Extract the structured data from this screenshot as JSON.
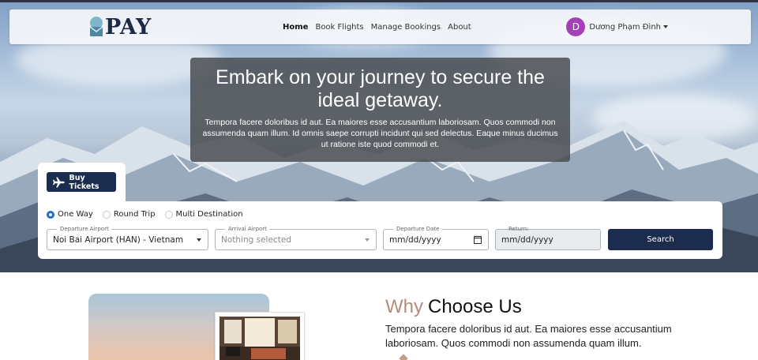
{
  "brand": {
    "logo_text": "PAY"
  },
  "nav": {
    "links": [
      {
        "label": "Home",
        "active": true
      },
      {
        "label": "Book Flights",
        "active": false
      },
      {
        "label": "Manage Bookings",
        "active": false
      },
      {
        "label": "About",
        "active": false
      }
    ]
  },
  "user": {
    "initial": "D",
    "name": "Dương Phạm Đình"
  },
  "hero": {
    "title": "Embark on your journey to secure the ideal getaway.",
    "subtitle": "Tempora facere doloribus id aut. Ea maiores esse accusantium laboriosam. Quos commodi non assumenda quam illum. Id omnis saepe corrupti incidunt qui sed delectus. Eaque minus ducimus ut ratione iste quod commodi et."
  },
  "booking": {
    "tab_label": "Buy Tickets",
    "trip_types": [
      {
        "label": "One Way",
        "selected": true
      },
      {
        "label": "Round Trip",
        "selected": false
      },
      {
        "label": "Multi Destination",
        "selected": false
      }
    ],
    "departure_airport": {
      "label": "Departure Airport",
      "value": "Noi Bai Airport (HAN) - Vietnam"
    },
    "arrival_airport": {
      "label": "Arrival Airport",
      "placeholder": "Nothing selected"
    },
    "departure_date": {
      "label": "Departure Date",
      "value": "mm/dd/yyyy"
    },
    "return_date": {
      "label": "Return:",
      "value": "mm/dd/yyyy",
      "disabled": true
    },
    "search_label": "Search"
  },
  "why": {
    "accent_word": "Why",
    "rest": "Choose Us",
    "text": "Tempora facere doloribus id aut. Ea maiores esse accusantium laboriosam. Quos commodi non assumenda quam illum."
  },
  "colors": {
    "primary": "#1c2c4f",
    "avatar": "#a640b9",
    "accent": "#b48b7e",
    "radio": "#1f6ad8"
  }
}
